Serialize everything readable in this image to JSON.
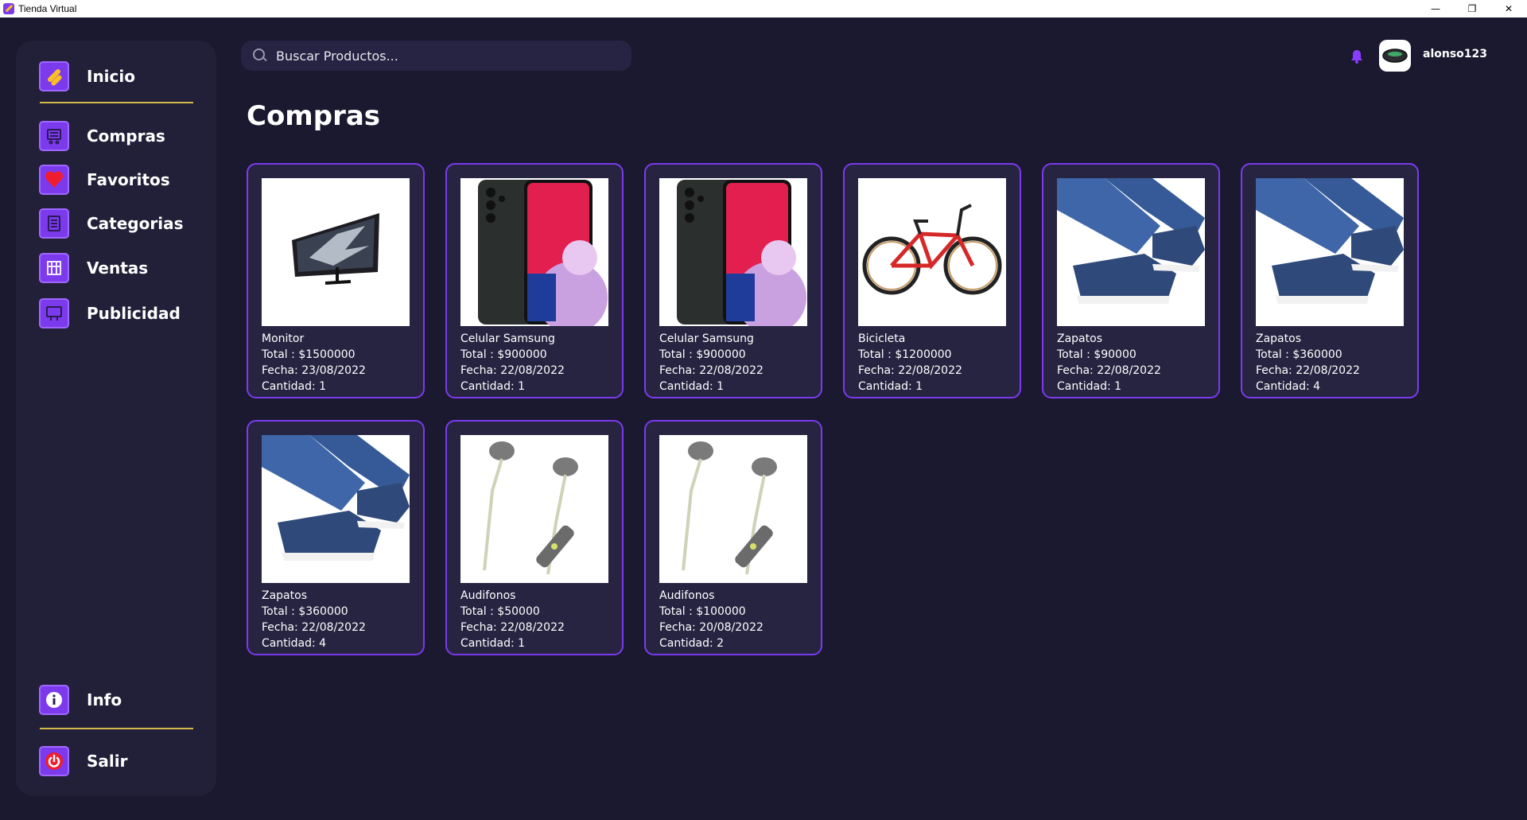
{
  "window": {
    "title": "Tienda Virtual",
    "controls": [
      "—",
      "❐",
      "✕"
    ]
  },
  "sidebar": {
    "home": {
      "label": "Inicio",
      "icon": "app-logo-icon"
    },
    "items": [
      {
        "label": "Compras",
        "icon": "cart-icon"
      },
      {
        "label": "Favoritos",
        "icon": "heart-icon"
      },
      {
        "label": "Categorias",
        "icon": "list-icon"
      },
      {
        "label": "Ventas",
        "icon": "store-icon"
      },
      {
        "label": "Publicidad",
        "icon": "billboard-icon"
      }
    ],
    "bottom": [
      {
        "label": "Info",
        "icon": "info-icon"
      },
      {
        "label": "Salir",
        "icon": "power-icon"
      }
    ]
  },
  "search": {
    "placeholder": "Buscar Productos..."
  },
  "user": {
    "name": "alonso123"
  },
  "colors": {
    "accent": "#7c3aed",
    "background": "#1a1930",
    "panel": "#222039",
    "divider": "#d4b84a"
  },
  "page": {
    "title": "Compras"
  },
  "purchases": [
    {
      "name": "Monitor",
      "total": "Total : $1500000",
      "date": "Fecha: 23/08/2022",
      "qty": "Cantidad: 1",
      "image": "monitor"
    },
    {
      "name": "Celular Samsung",
      "total": "Total : $900000",
      "date": "Fecha: 22/08/2022",
      "qty": "Cantidad: 1",
      "image": "phone"
    },
    {
      "name": "Celular Samsung",
      "total": "Total : $900000",
      "date": "Fecha: 22/08/2022",
      "qty": "Cantidad: 1",
      "image": "phone"
    },
    {
      "name": "Bicicleta",
      "total": "Total : $1200000",
      "date": "Fecha: 22/08/2022",
      "qty": "Cantidad: 1",
      "image": "bike"
    },
    {
      "name": "Zapatos",
      "total": "Total : $90000",
      "date": "Fecha: 22/08/2022",
      "qty": "Cantidad: 1",
      "image": "shoes"
    },
    {
      "name": "Zapatos",
      "total": "Total : $360000",
      "date": "Fecha: 22/08/2022",
      "qty": "Cantidad: 4",
      "image": "shoes"
    },
    {
      "name": "Zapatos",
      "total": "Total : $360000",
      "date": "Fecha: 22/08/2022",
      "qty": "Cantidad: 4",
      "image": "shoes"
    },
    {
      "name": "Audifonos",
      "total": "Total : $50000",
      "date": "Fecha: 22/08/2022",
      "qty": "Cantidad: 1",
      "image": "earphones"
    },
    {
      "name": "Audifonos",
      "total": "Total : $100000",
      "date": "Fecha: 20/08/2022",
      "qty": "Cantidad: 2",
      "image": "earphones"
    }
  ]
}
